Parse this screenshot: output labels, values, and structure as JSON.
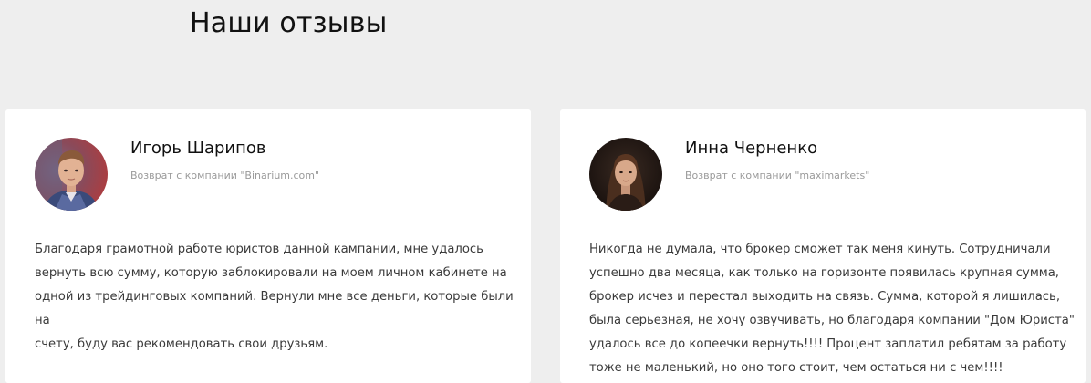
{
  "section": {
    "title": "Наши отзывы"
  },
  "reviews": [
    {
      "name": "Игорь Шарипов",
      "subtitle": "Возврат с компании \"Binarium.com\"",
      "avatar": "man-portrait-avatar",
      "text": "Благодаря грамотной работе юристов данной кампании, мне удалось\nвернуть всю сумму, которую заблокировали на моем личном кабинете на\nодной из трейдинговых компаний. Вернули мне все деньги, которые были на\nсчету, буду вас рекомендовать свои друзьям."
    },
    {
      "name": "Инна Черненко",
      "subtitle": "Возврат с компании \"maximarkets\"",
      "avatar": "woman-portrait-avatar",
      "text": "Никогда не думала, что брокер сможет так меня кинуть. Сотрудничали\nуспешно два месяца, как только на горизонте появилась крупная сумма,\nброкер исчез и перестал выходить на связь. Сумма, которой я лишилась,\nбыла серьезная, не хочу озвучивать, но благодаря компании \"Дом Юриста\"\nудалось все до копеечки вернуть!!!! Процент заплатил ребятам за работу\nтоже не маленький, но оно того стоит, чем остаться ни с чем!!!!"
    }
  ],
  "colors": {
    "page_background": "#eeeeee",
    "card_background": "#ffffff",
    "heading": "#111111",
    "subtitle": "#9a9a9a",
    "body_text": "#3a3a3a"
  }
}
